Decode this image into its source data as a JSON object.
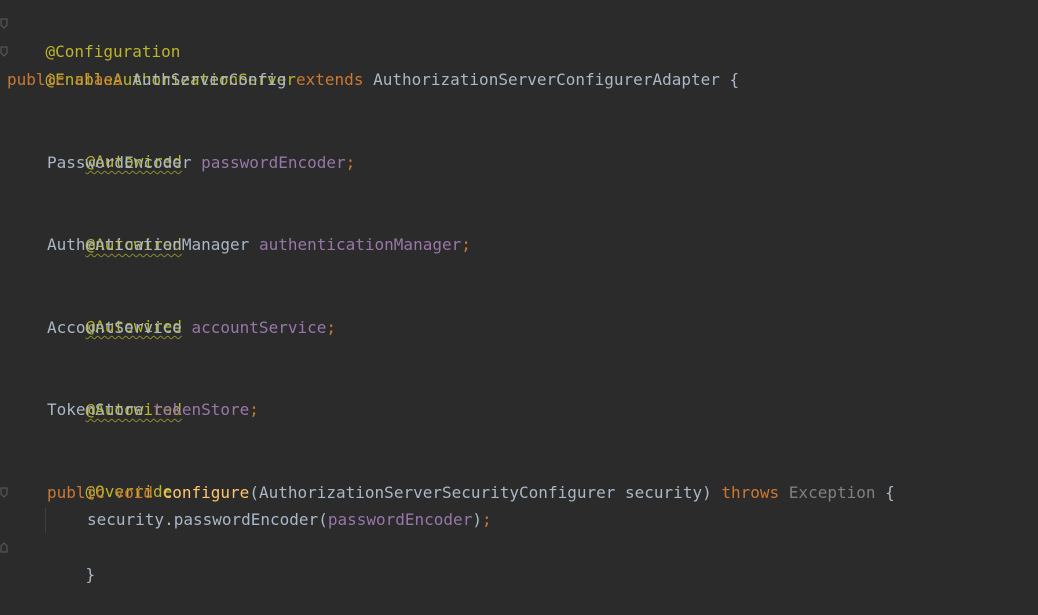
{
  "code": {
    "l1": {
      "annotation": "@Configuration"
    },
    "l2": {
      "annotation": "@EnableAuthorizationServer"
    },
    "l3": {
      "kw_public": "public",
      "kw_class": "class",
      "class_name": "AuthServerConfig",
      "kw_extends": "extends",
      "super_name": "AuthorizationServerConfigurerAdapter",
      "brace": "{"
    },
    "l5": {
      "annotation": "@Autowired"
    },
    "l6": {
      "type": "PasswordEncoder",
      "field": "passwordEncoder",
      "semicolon": ";"
    },
    "l8": {
      "annotation": "@Autowired"
    },
    "l9": {
      "type": "AuthenticationManager",
      "field": "authenticationManager",
      "semicolon": ";"
    },
    "l11": {
      "annotation": "@Autowired"
    },
    "l12": {
      "type": "AccountService",
      "field": "accountService",
      "semicolon": ";"
    },
    "l14": {
      "annotation": "@Autowired"
    },
    "l15": {
      "type": "TokenStore",
      "field": "tokenStore",
      "semicolon": ";"
    },
    "l17": {
      "annotation": "@Override"
    },
    "l18": {
      "kw_public": "public",
      "kw_void": "void",
      "method": "configure",
      "paren_open": "(",
      "param_type": "AuthorizationServerSecurityConfigurer",
      "param_name": "security",
      "paren_close": ")",
      "kw_throws": "throws",
      "exception": "Exception",
      "brace": "{"
    },
    "l19": {
      "receiver": "security.passwordEncoder",
      "paren_open": "(",
      "arg": "passwordEncoder",
      "paren_close": ")",
      "semicolon": ";"
    },
    "l20": {
      "brace": "}"
    }
  },
  "colors": {
    "background": "#2b2b2b",
    "text": "#a9b7c6",
    "annotation": "#bbb529",
    "keyword": "#cc7832",
    "method": "#ffc66d",
    "field": "#9876aa",
    "unused": "#808080"
  },
  "gutter_icons": [
    "fold-marker-icon",
    "fold-marker-icon",
    "override-method-icon",
    "fold-end-marker-icon"
  ]
}
